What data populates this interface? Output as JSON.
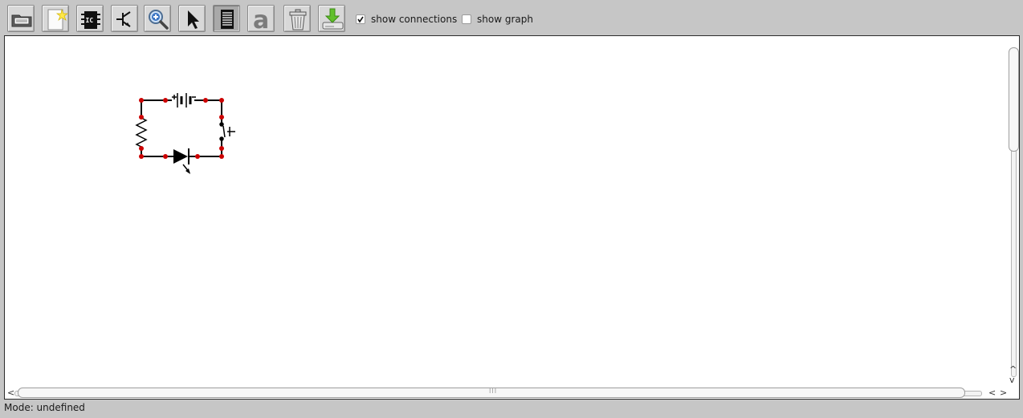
{
  "toolbar": {
    "buttons": [
      {
        "name": "open-button",
        "icon": "folder-icon"
      },
      {
        "name": "new-button",
        "icon": "new-document-icon"
      },
      {
        "name": "ic-button",
        "icon": "ic-chip-icon"
      },
      {
        "name": "transistor-button",
        "icon": "transistor-icon"
      },
      {
        "name": "zoom-button",
        "icon": "zoom-in-icon"
      },
      {
        "name": "select-button",
        "icon": "pointer-arrow-icon"
      },
      {
        "name": "wire-button",
        "icon": "wire-icon",
        "pressed": true
      },
      {
        "name": "text-button",
        "icon": "text-a-icon"
      },
      {
        "name": "delete-button",
        "icon": "trash-icon"
      },
      {
        "name": "save-button",
        "icon": "download-icon"
      }
    ],
    "ic_chip_text": "IC",
    "text_tool_glyph": "a",
    "show_connections": {
      "label": "show connections",
      "checked": true
    },
    "show_graph": {
      "label": "show graph",
      "checked": false
    }
  },
  "circuit": {
    "components": [
      "battery",
      "switch",
      "resistor",
      "led"
    ],
    "wire_color": "#000000",
    "node_color": "#cc0000"
  },
  "scrollbars": {
    "vertical_arrows": [
      "^",
      "v"
    ],
    "horizontal_arrows": [
      "<",
      ">"
    ],
    "grip": "III"
  },
  "statusbar": {
    "text": "Mode: undefined"
  }
}
